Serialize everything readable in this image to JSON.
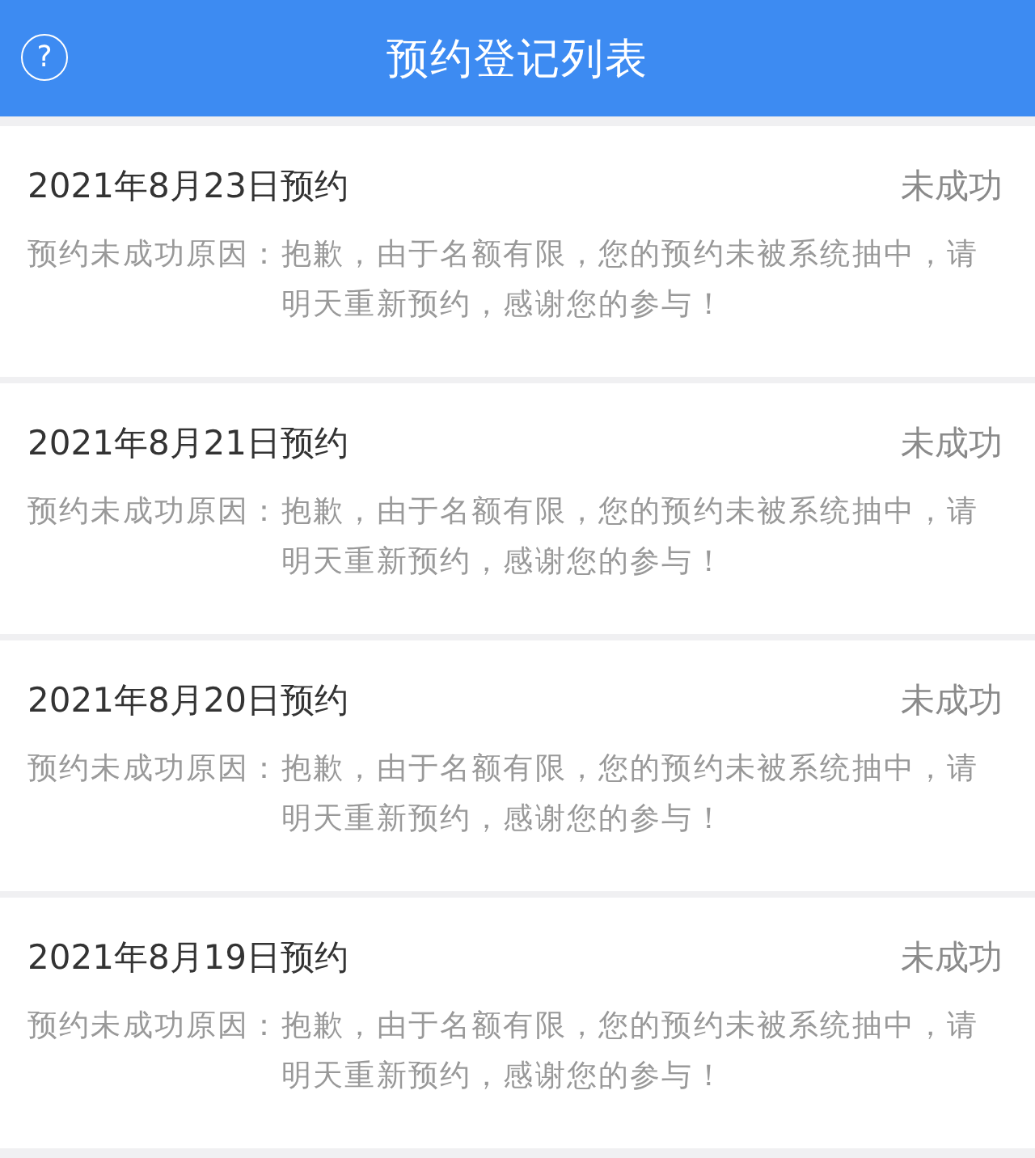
{
  "header": {
    "help_icon": "?",
    "title": "预约登记列表"
  },
  "records": [
    {
      "date": "2021年8月23日预约",
      "status": "未成功",
      "reason_label": "预约未成功原因：",
      "reason": "抱歉，由于名额有限，您的预约未被系统抽中，请明天重新预约，感谢您的参与！"
    },
    {
      "date": "2021年8月21日预约",
      "status": "未成功",
      "reason_label": "预约未成功原因：",
      "reason": "抱歉，由于名额有限，您的预约未被系统抽中，请明天重新预约，感谢您的参与！"
    },
    {
      "date": "2021年8月20日预约",
      "status": "未成功",
      "reason_label": "预约未成功原因：",
      "reason": "抱歉，由于名额有限，您的预约未被系统抽中，请明天重新预约，感谢您的参与！"
    },
    {
      "date": "2021年8月19日预约",
      "status": "未成功",
      "reason_label": "预约未成功原因：",
      "reason": "抱歉，由于名额有限，您的预约未被系统抽中，请明天重新预约，感谢您的参与！"
    }
  ]
}
